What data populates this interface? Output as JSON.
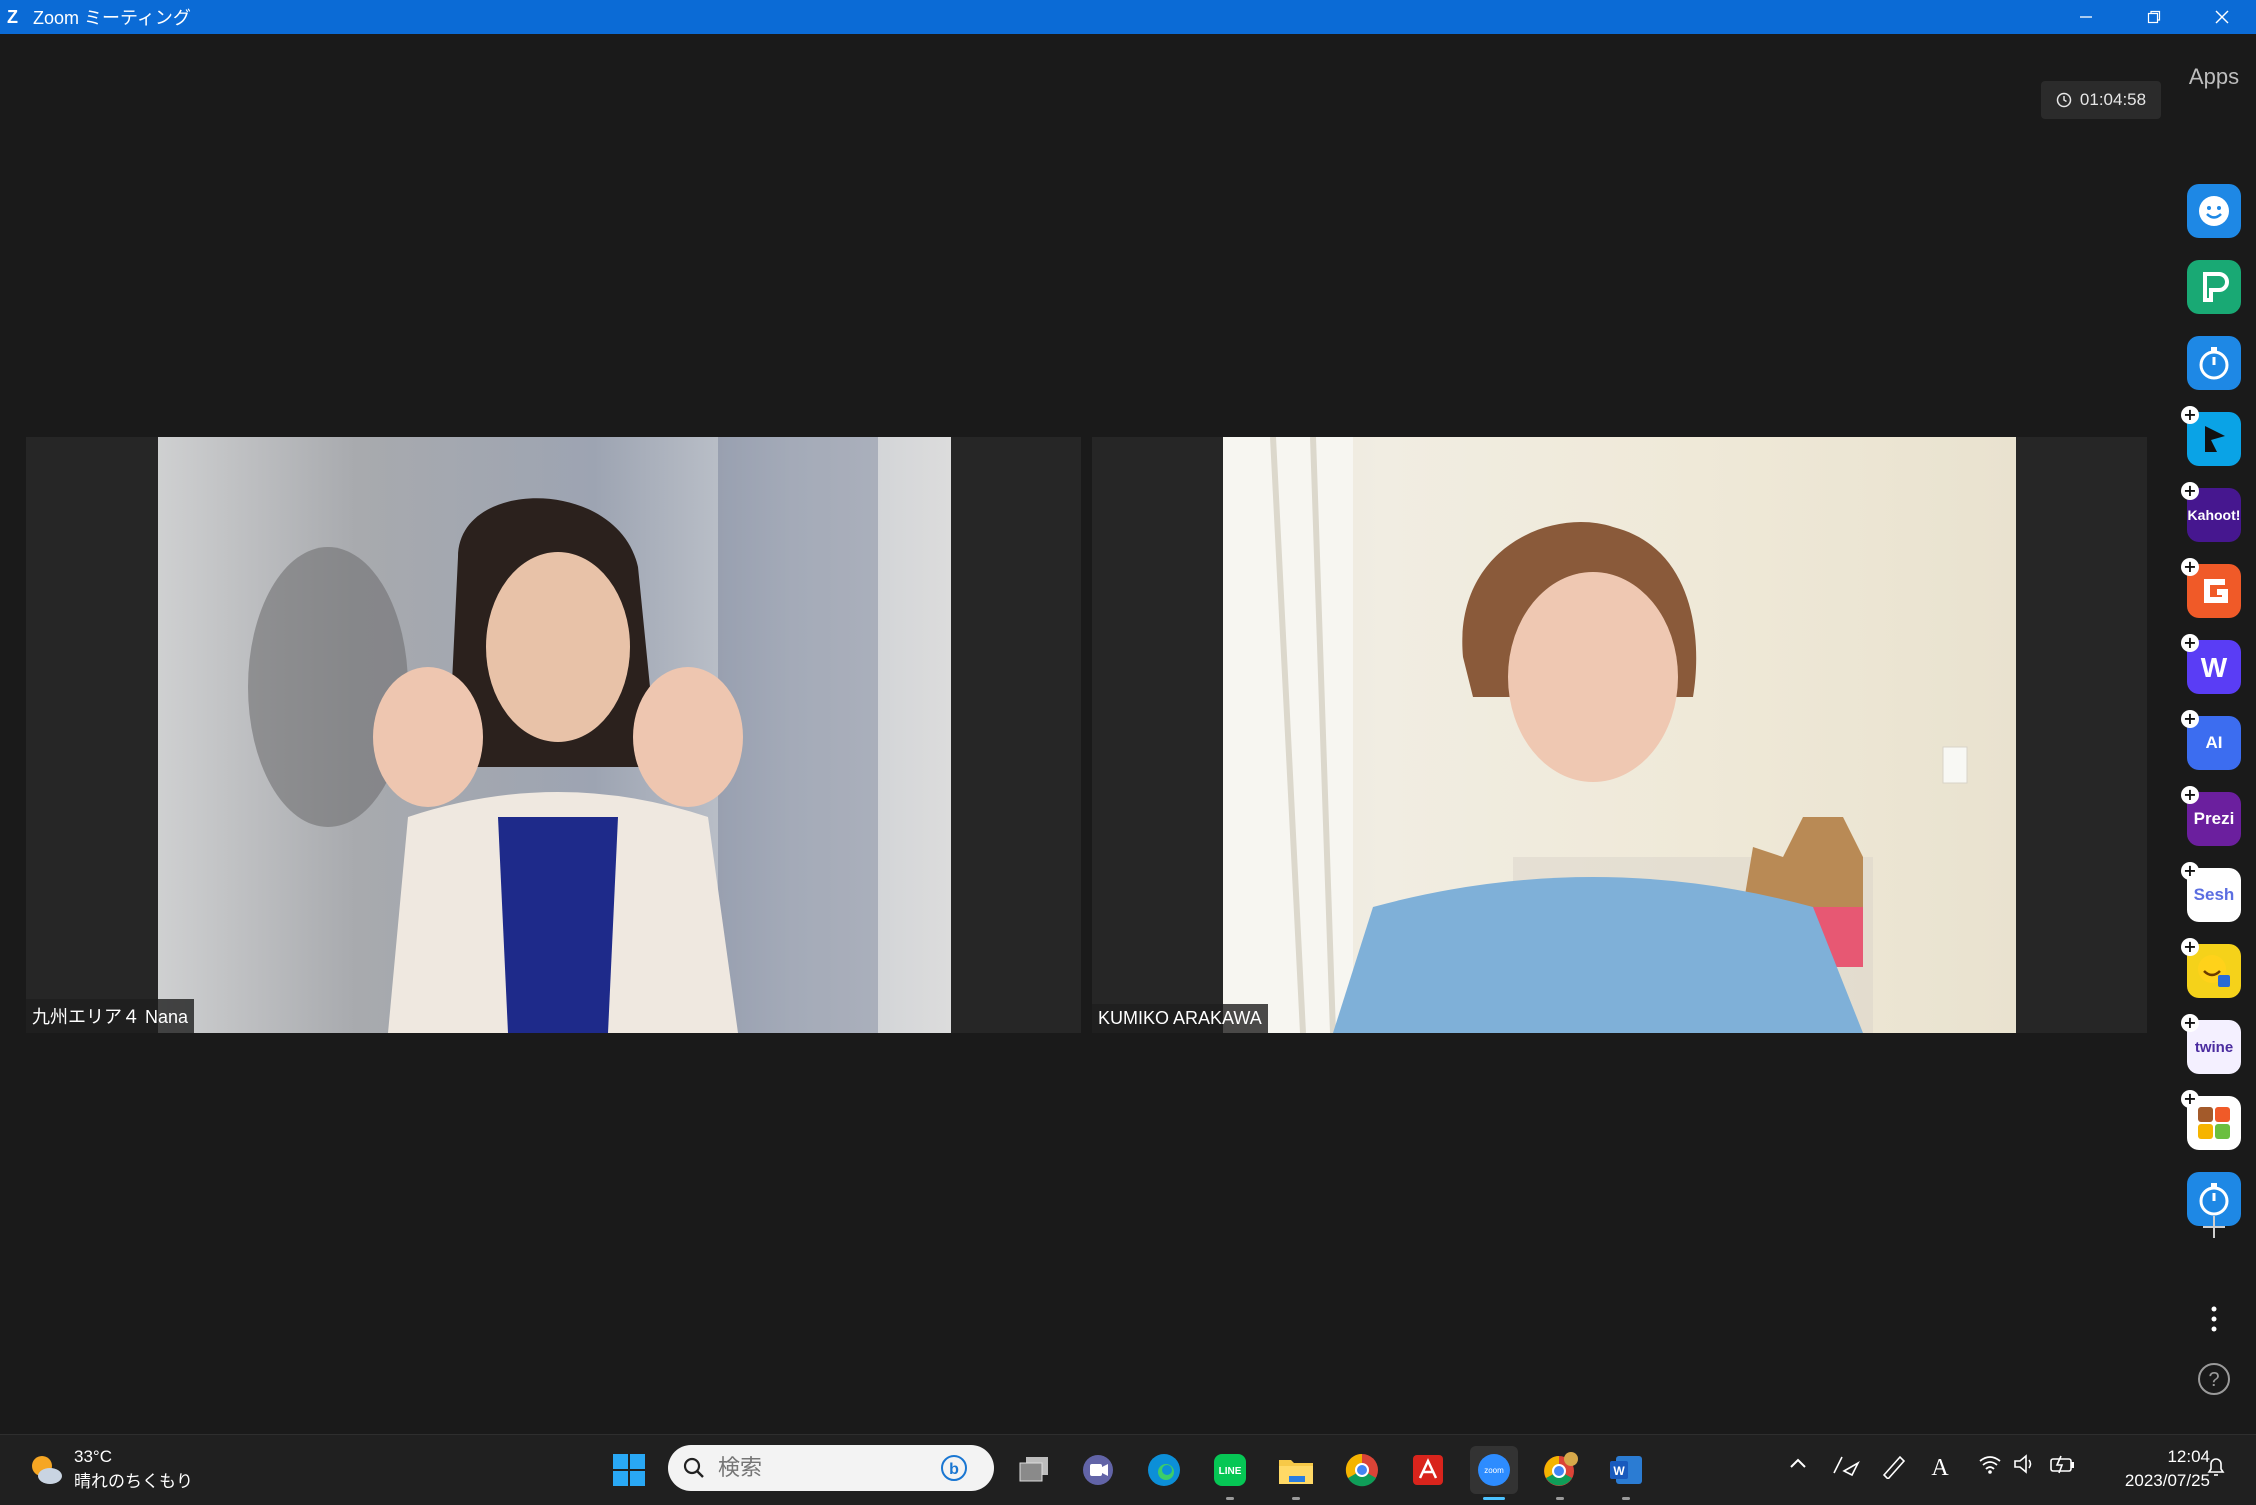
{
  "window": {
    "title": "Zoom ミーティング"
  },
  "meeting": {
    "timer": "01:04:58",
    "participants": [
      {
        "name": "九州エリア４ Nana"
      },
      {
        "name": "KUMIKO ARAKAWA"
      }
    ]
  },
  "apps_panel": {
    "title": "Apps",
    "items": [
      {
        "name": "smile-app",
        "color": "#1e88e5",
        "label": ""
      },
      {
        "name": "p-app",
        "color": "#19a974",
        "label": ""
      },
      {
        "name": "timer-app",
        "color": "#1e88e5",
        "label": ""
      },
      {
        "name": "flag-app",
        "color": "#0aa3e6",
        "label": ""
      },
      {
        "name": "kahoot-app",
        "color": "#46178f",
        "label": "Kahoot!"
      },
      {
        "name": "c-app",
        "color": "#f05a28",
        "label": ""
      },
      {
        "name": "w-app",
        "color": "#5a3df5",
        "label": ""
      },
      {
        "name": "ai-app",
        "color": "#3c6df0",
        "label": "AI"
      },
      {
        "name": "prezi-app",
        "color": "#6b1f9e",
        "label": "Prezi"
      },
      {
        "name": "sesh-app",
        "color": "#ffffff",
        "label": "Sesh"
      },
      {
        "name": "emoji-app",
        "color": "#f5d21a",
        "label": ""
      },
      {
        "name": "twine-app",
        "color": "#f4f0ff",
        "label": "twine"
      },
      {
        "name": "blocks-app",
        "color": "#ffffff",
        "label": ""
      },
      {
        "name": "stopwatch-app",
        "color": "#1e88e5",
        "label": ""
      }
    ]
  },
  "taskbar": {
    "weather": {
      "temp": "33°C",
      "condition": "晴れのちくもり"
    },
    "search": {
      "placeholder": "検索"
    },
    "clock": {
      "time": "12:04",
      "date": "2023/07/25"
    }
  }
}
